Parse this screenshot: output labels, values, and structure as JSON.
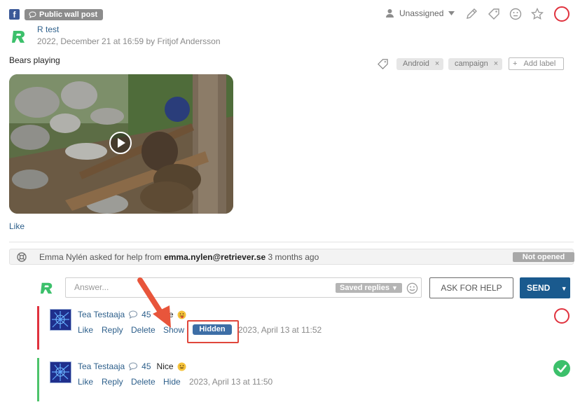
{
  "header": {
    "network_icon": "facebook-icon",
    "network_icon_glyph": "f",
    "post_type": "Public wall post",
    "assignee": "Unassigned"
  },
  "post": {
    "author": "R test",
    "meta": "2022, December 21 at 16:59 by Fritjof Andersson",
    "text": "Bears playing",
    "labels": [
      "Android",
      "campaign"
    ],
    "add_label": "Add label",
    "like": "Like"
  },
  "help": {
    "who": "Emma Nylén asked for help from ",
    "email": "emma.nylen@retriever.se",
    "when": " 3 months ago",
    "status": "Not opened"
  },
  "reply": {
    "placeholder": "Answer...",
    "saved_replies": "Saved replies",
    "ask_help": "ASK FOR HELP",
    "send": "SEND"
  },
  "comments": [
    {
      "name": "Tea Testaaja",
      "count": "45",
      "text": "Nice",
      "actions": [
        "Like",
        "Reply",
        "Delete",
        "Show"
      ],
      "badge": "Hidden",
      "time": "2023, April 13 at 11:52",
      "status_color": "#e0323e"
    },
    {
      "name": "Tea Testaaja",
      "count": "45",
      "text": "Nice",
      "actions": [
        "Like",
        "Reply",
        "Delete",
        "Hide"
      ],
      "time": "2023, April 13 at 11:50",
      "status_color": "#3cc06b"
    }
  ],
  "colors": {
    "link": "#2d5f8b",
    "primary": "#1a5a8e",
    "hidden_comment_bar": "#e0323e",
    "visible_comment_bar": "#4dc36a",
    "annotation": "#e0463b"
  }
}
